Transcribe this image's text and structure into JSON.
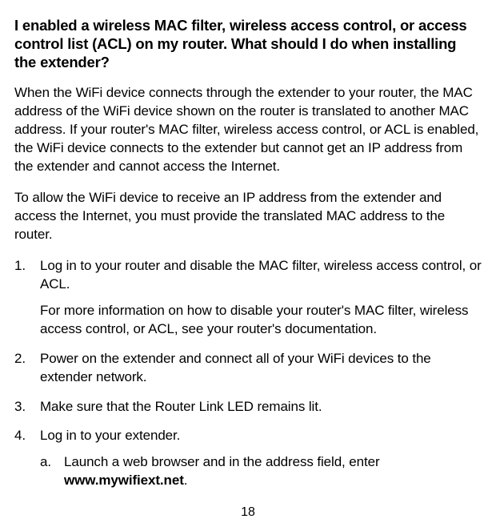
{
  "heading": "I enabled a wireless MAC filter, wireless access control, or access control list (ACL) on my router. What should I do when installing the extender?",
  "paragraph1": "When the WiFi device connects through the extender to your router, the MAC address of the WiFi device shown on the router is translated to another MAC address. If your router's MAC filter, wireless access control, or ACL is enabled, the WiFi device connects to the extender but cannot get an IP address from the extender and cannot access the Internet.",
  "paragraph2": "To allow the WiFi device to receive an IP address from the extender and access the Internet, you must provide the translated MAC address to the router.",
  "steps": {
    "step1": "Log in to your router and disable the MAC filter, wireless access control, or ACL.",
    "step1_sub": "For more information on how to disable your router's MAC filter, wireless access control, or ACL, see your router's documentation.",
    "step2": "Power on the extender and connect all of your WiFi devices to the extender network.",
    "step3": "Make sure that the Router Link LED remains lit.",
    "step4": "Log in to your extender.",
    "step4a_prefix": "Launch a web browser and in the address field, enter ",
    "step4a_bold": "www.mywifiext.net",
    "step4a_suffix": "."
  },
  "page_number": "18"
}
